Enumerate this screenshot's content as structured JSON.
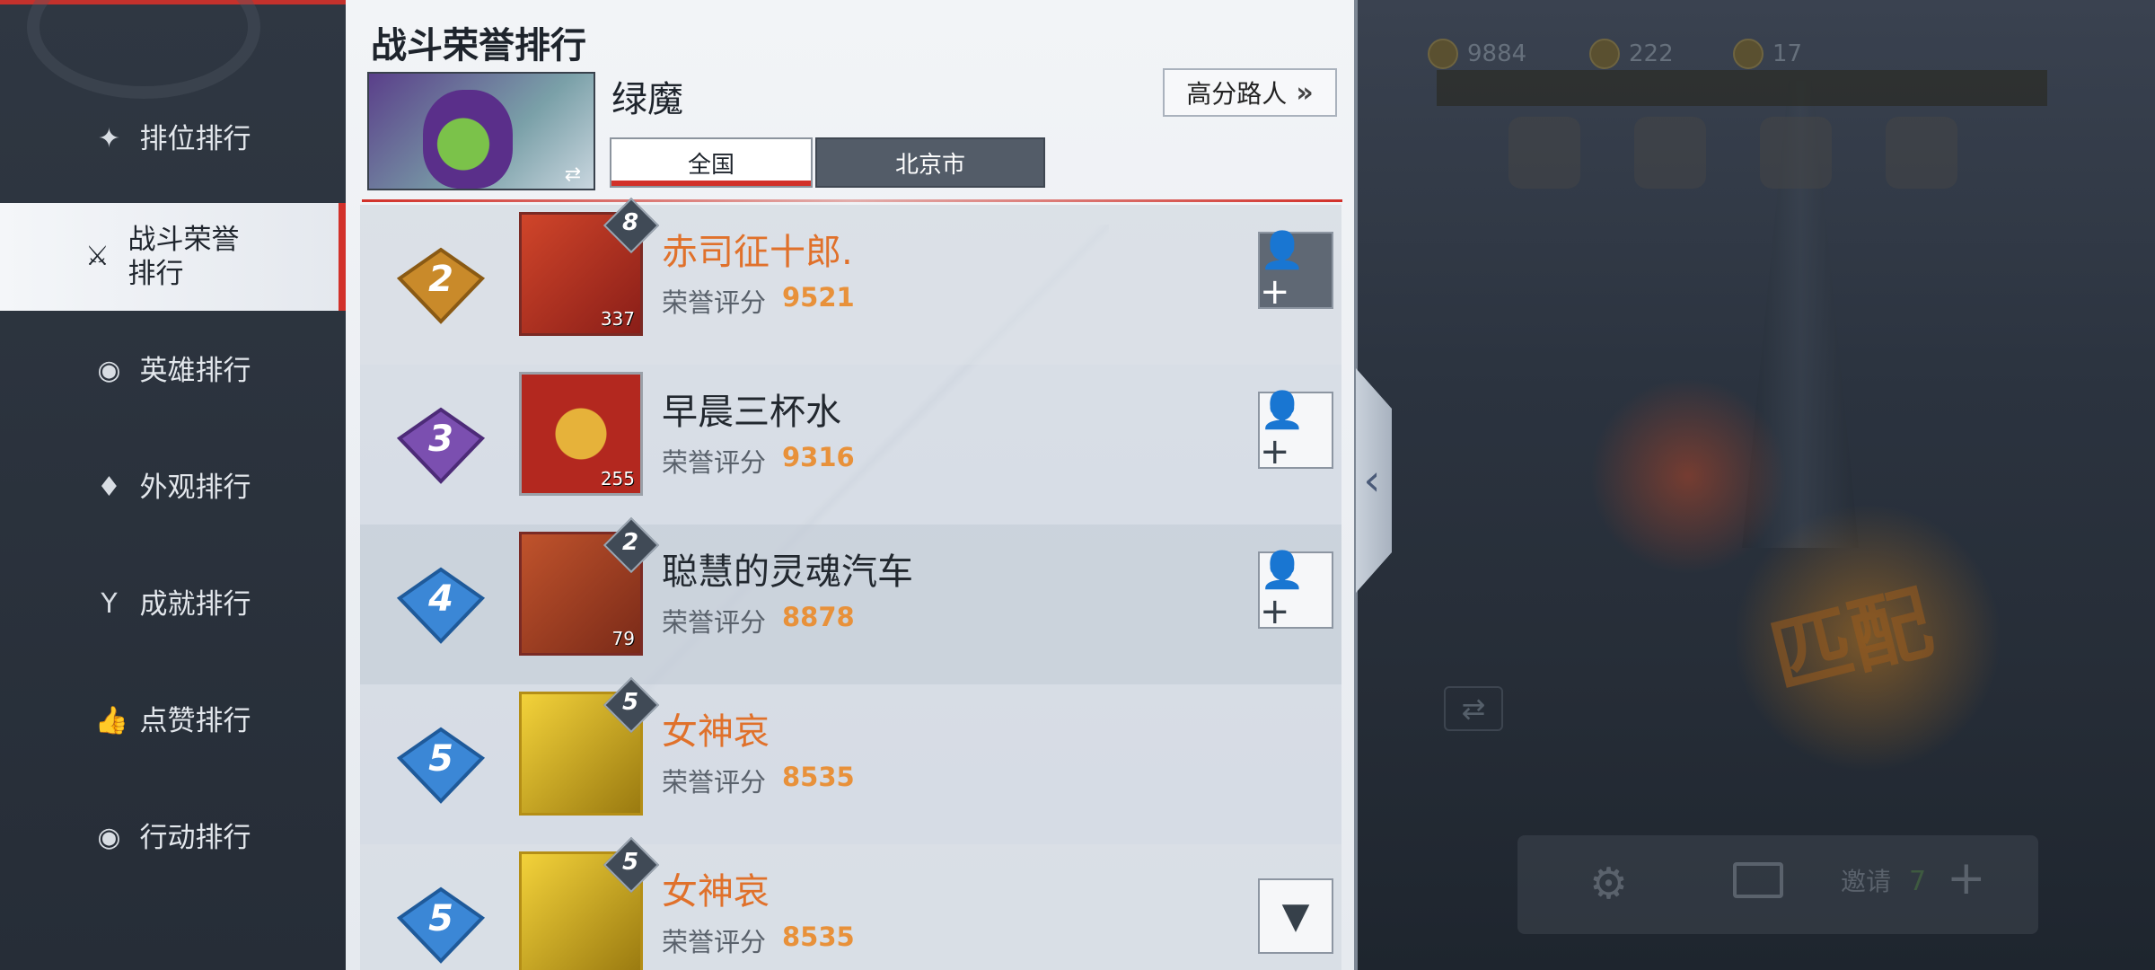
{
  "sidebar": {
    "items": [
      {
        "label": "排位排行",
        "icon": "star-burst-icon"
      },
      {
        "label": "战斗荣誉排行",
        "icon": "crossed-swords-icon",
        "active": true
      },
      {
        "label": "英雄排行",
        "icon": "hero-mask-icon"
      },
      {
        "label": "外观排行",
        "icon": "costume-icon"
      },
      {
        "label": "成就排行",
        "icon": "achievement-icon"
      },
      {
        "label": "点赞排行",
        "icon": "thumbs-up-icon"
      },
      {
        "label": "行动排行",
        "icon": "action-icon"
      }
    ]
  },
  "panel": {
    "title": "战斗荣誉排行",
    "hero_name": "绿魔",
    "high_score_button": "高分路人",
    "region_tabs": {
      "national": "全国",
      "city": "北京市"
    }
  },
  "rows": [
    {
      "rank": "2",
      "badge_color": "#c98a2a",
      "name": "赤司征十郎.",
      "name_style": "gold",
      "score_label": "荣誉评分",
      "score": "9521",
      "avatar_level": "337",
      "star": "8",
      "action": "add-friend"
    },
    {
      "rank": "3",
      "badge_color": "#7b4fb0",
      "name": "早晨三杯水",
      "name_style": "dark",
      "score_label": "荣誉评分",
      "score": "9316",
      "avatar_level": "255",
      "star": "",
      "action": "add-friend"
    },
    {
      "rank": "4",
      "badge_color": "#3b87d6",
      "name": "聪慧的灵魂汽车",
      "name_style": "dark",
      "score_label": "荣誉评分",
      "score": "8878",
      "avatar_level": "79",
      "star": "2",
      "action": "add-friend"
    },
    {
      "rank": "5",
      "badge_color": "#3b87d6",
      "name": "女神哀",
      "name_style": "gold",
      "score_label": "荣誉评分",
      "score": "8535",
      "avatar_level": "",
      "star": "5",
      "action": "none"
    },
    {
      "rank": "5",
      "badge_color": "#3b87d6",
      "name": "女神哀",
      "name_style": "gold",
      "score_label": "荣誉评分",
      "score": "8535",
      "avatar_level": "",
      "star": "5",
      "action": "rank-badge"
    }
  ],
  "scene": {
    "resources": [
      "9884",
      "222",
      "17"
    ],
    "match_label": "匹配",
    "invite_label": "邀请",
    "invite_count": "7"
  },
  "colors": {
    "accent_red": "#d2312a",
    "score_orange": "#e8913a",
    "name_orange": "#e0712b"
  }
}
